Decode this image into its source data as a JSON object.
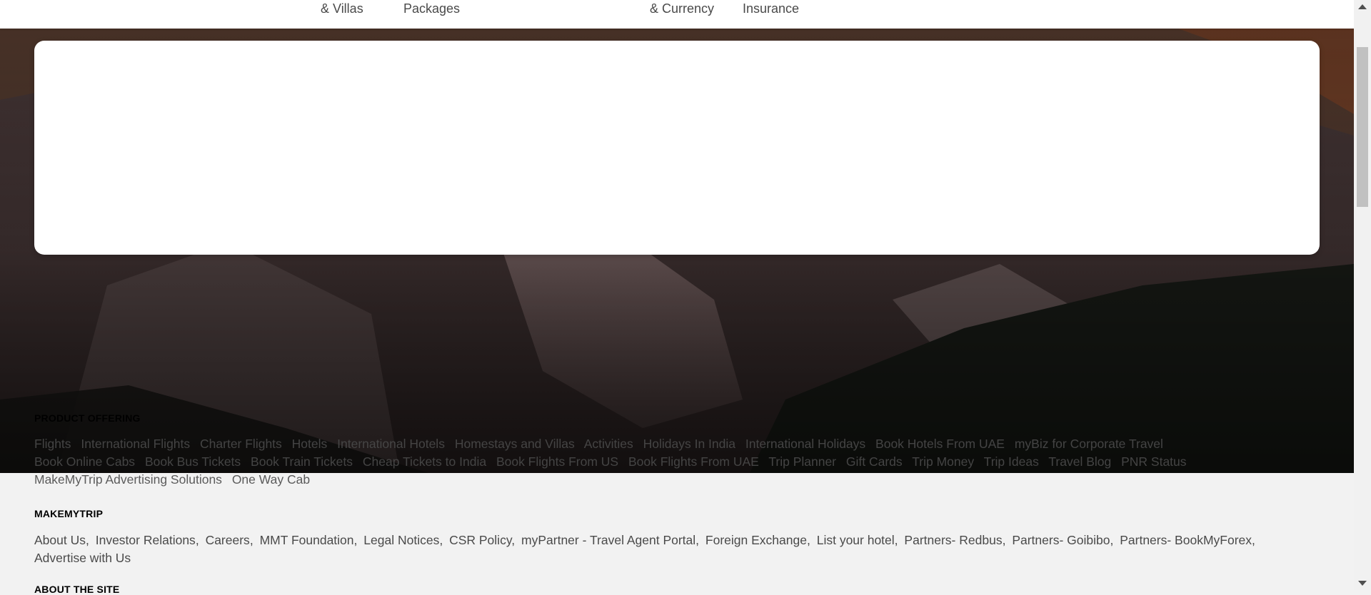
{
  "topnav": {
    "items": [
      {
        "label": "& Villas"
      },
      {
        "label": "Packages"
      },
      {
        "label": "& Currency"
      },
      {
        "label": "Insurance"
      }
    ]
  },
  "footer": {
    "product_offering": {
      "title": "PRODUCT OFFERING",
      "links": [
        "Flights",
        "International Flights",
        "Charter Flights",
        "Hotels",
        "International Hotels",
        "Homestays and Villas",
        "Activities",
        "Holidays In India",
        "International Holidays",
        "Book Hotels From UAE",
        "myBiz for Corporate Travel",
        "Book Online Cabs",
        "Book Bus Tickets",
        "Book Train Tickets",
        "Cheap Tickets to India",
        "Book Flights From US",
        "Book Flights From UAE",
        "Trip Planner",
        "Gift Cards",
        "Trip Money",
        "Trip Ideas",
        "Travel Blog",
        "PNR Status",
        "MakeMyTrip Advertising Solutions",
        "One Way Cab"
      ]
    },
    "makemytrip": {
      "title": "MAKEMYTRIP",
      "links": [
        "About Us",
        "Investor Relations",
        "Careers",
        "MMT Foundation",
        "Legal Notices",
        "CSR Policy",
        "myPartner - Travel Agent Portal",
        "Foreign Exchange",
        "List your hotel",
        "Partners- Redbus",
        "Partners- Goibibo",
        "Partners- BookMyForex",
        "Advertise with Us"
      ]
    },
    "about_site": {
      "title": "ABOUT THE SITE"
    }
  },
  "colors": {
    "page_bg": "#f2f2f2",
    "card_bg": "#ffffff",
    "link_text": "#4a4a4a",
    "section_title": "#000000"
  }
}
